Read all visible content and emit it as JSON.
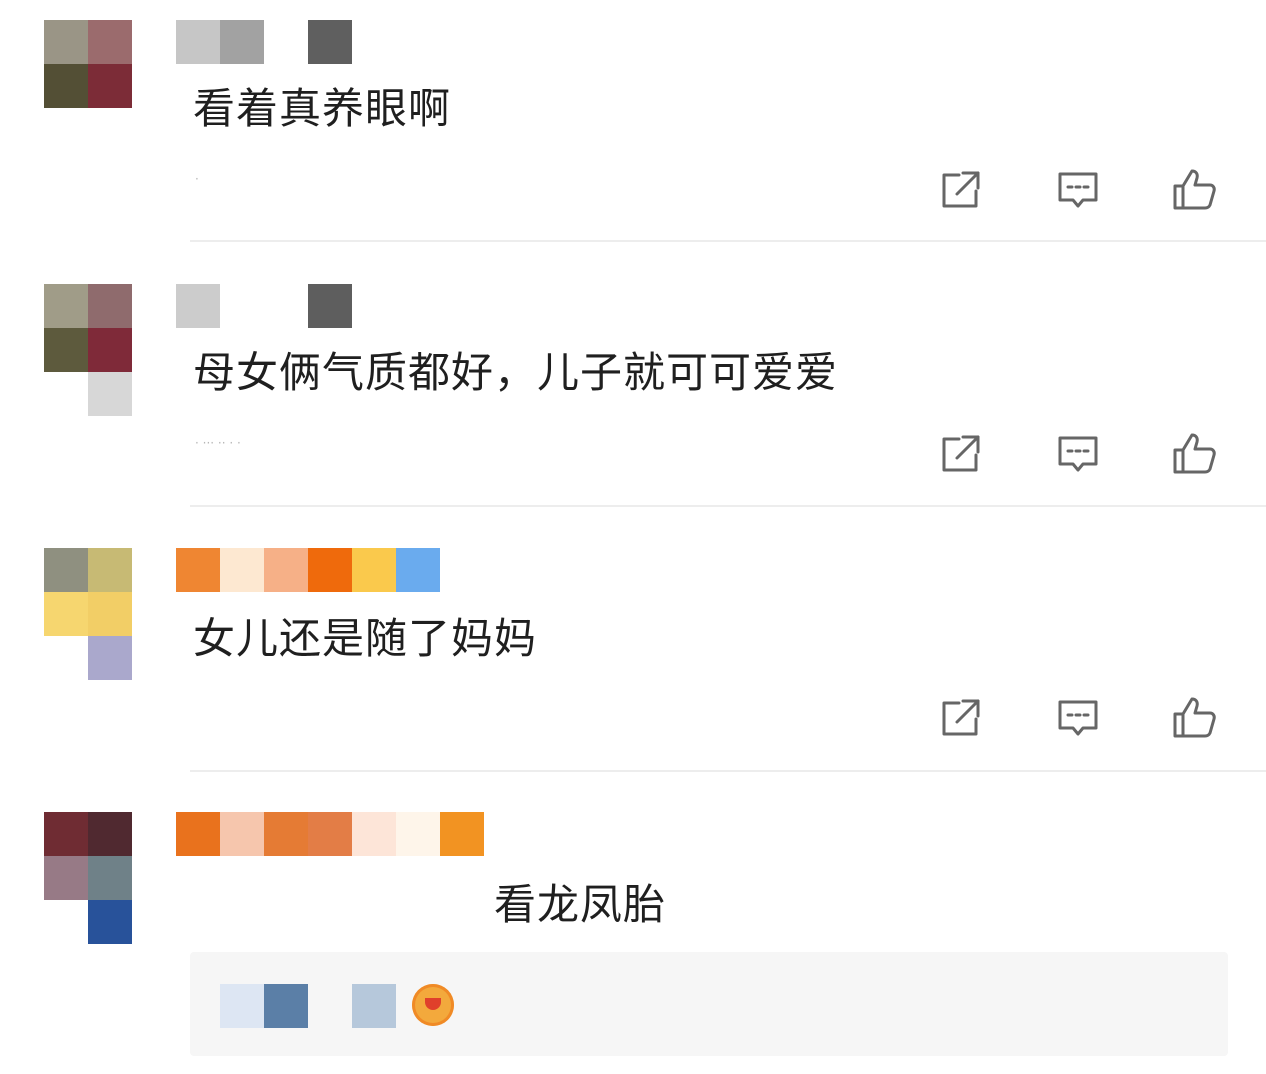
{
  "comments": [
    {
      "text": "看着真养眼啊",
      "meta": "·",
      "avatar_colors": [
        "#9a9586",
        "#9b6b6d",
        "#534f35",
        "#7c2c37"
      ],
      "name_colors": [
        "#c6c6c6",
        "#a2a2a2",
        "",
        "#5f5f5f"
      ]
    },
    {
      "text": "母女俩气质都好，儿子就可可爱爱",
      "meta": "·  ···  ··  · ·",
      "avatar_colors": [
        "#a09c88",
        "#8f6b6d",
        "#5d5a3d",
        "#7f2a39",
        "",
        "#d7d7d7"
      ],
      "name_colors": [
        "#cccccc",
        "",
        "",
        "#5e5e5e"
      ]
    },
    {
      "text": "女儿还是随了妈妈",
      "meta": "",
      "avatar_colors": [
        "#8f9080",
        "#c7ba74",
        "#f6d66f",
        "#f2ce66",
        "",
        "#aaa8cc"
      ],
      "name_colors": [
        "#ef8632",
        "#fde8d1",
        "#f6b087",
        "#ef6a0c",
        "#fac94c",
        "#6aabee"
      ]
    },
    {
      "text": "看龙凤胎",
      "meta": "",
      "avatar_colors": [
        "#6f2c33",
        "#502930",
        "#977a86",
        "#6f8188",
        "",
        "#28529a"
      ],
      "name_colors": [
        "#e9721d",
        "#f6c6ad",
        "#e57b34",
        "#e37d46",
        "#fde5d8",
        "#fef5ea",
        "#f29322"
      ]
    }
  ],
  "reply": {
    "name_colors": [
      "#dde6f3",
      "#5b7fa7",
      "",
      "#b6c8db"
    ],
    "emoji": "smiling-emoji"
  },
  "icons": [
    "share-icon",
    "comment-icon",
    "like-icon"
  ],
  "colors": {
    "icon": "#666666",
    "divider": "#ededed",
    "reply_bg": "#f6f6f6"
  }
}
